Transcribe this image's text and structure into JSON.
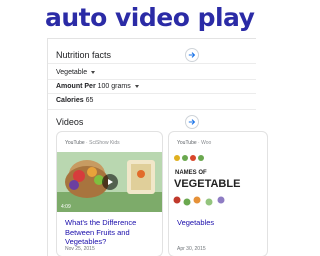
{
  "heading": "auto video play",
  "nutrition": {
    "title": "Nutrition facts",
    "food_select": "Vegetable",
    "amount_label": "Amount Per",
    "amount_value": "100 grams",
    "calories_label": "Calories",
    "calories_value": "65"
  },
  "videos": {
    "title": "Videos",
    "items": [
      {
        "source": "YouTube",
        "channel": "SciShow Kids",
        "duration": "4:09",
        "title": "What's the Difference Between Fruits and Vegetables?",
        "date": "Nov 25, 2015"
      },
      {
        "source": "YouTube",
        "channel": "Woo",
        "thumb_text_1": "NAMES OF",
        "thumb_text_2": "VEGETABLE",
        "title": "Vegetables",
        "date": "Apr 30, 2015"
      }
    ]
  },
  "colors": {
    "heading": "#2b2ba6",
    "link": "#1a0dab",
    "accent": "#1a73e8"
  }
}
